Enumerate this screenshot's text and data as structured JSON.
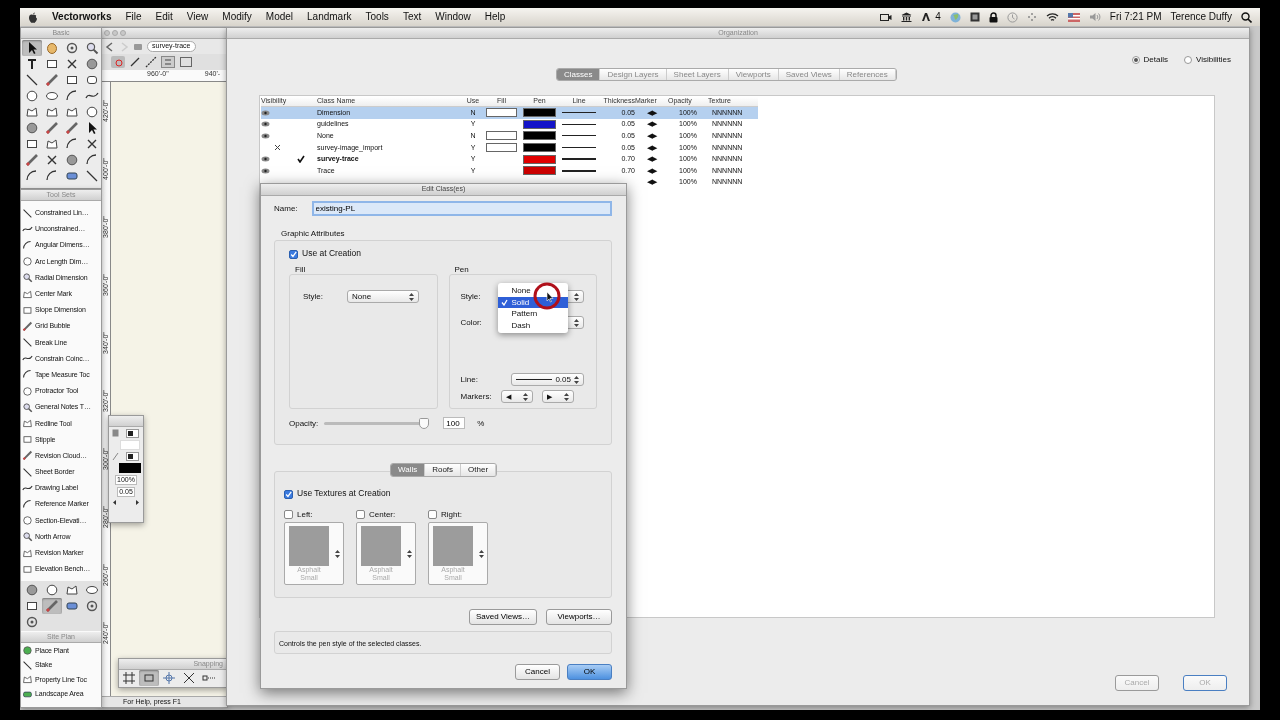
{
  "menu_bar": {
    "app": "Vectorworks",
    "menus": [
      "File",
      "Edit",
      "View",
      "Modify",
      "Model",
      "Landmark",
      "Tools",
      "Text",
      "Window",
      "Help"
    ],
    "status_count": "4",
    "clock": "Fri 7:21 PM",
    "user": "Terence Duffy"
  },
  "basic_palette": {
    "title": "Basic",
    "tools": [
      {
        "kind": "arrow",
        "selected": true
      },
      {
        "kind": "hand",
        "selected": false
      },
      {
        "kind": "pan",
        "selected": false
      },
      {
        "kind": "zoom",
        "selected": false
      },
      {
        "kind": "text",
        "selected": false
      },
      {
        "kind": "rect",
        "selected": false
      },
      {
        "kind": "cross",
        "selected": false
      },
      {
        "kind": "fill",
        "selected": false
      },
      {
        "kind": "line",
        "selected": false
      },
      {
        "kind": "pencil",
        "selected": false
      },
      {
        "kind": "rect",
        "selected": false
      },
      {
        "kind": "rrect",
        "selected": false
      },
      {
        "kind": "circle",
        "selected": false
      },
      {
        "kind": "oval",
        "selected": false
      },
      {
        "kind": "arc",
        "selected": false
      },
      {
        "kind": "curve",
        "selected": false
      },
      {
        "kind": "polygon",
        "selected": false
      },
      {
        "kind": "polygon",
        "selected": false
      },
      {
        "kind": "polygon",
        "selected": false
      },
      {
        "kind": "circle",
        "selected": false
      },
      {
        "kind": "fill",
        "selected": false
      },
      {
        "kind": "pencil",
        "selected": false
      },
      {
        "kind": "pencil",
        "selected": false
      },
      {
        "kind": "arrow",
        "selected": false
      },
      {
        "kind": "rect",
        "selected": false
      },
      {
        "kind": "polygon",
        "selected": false
      },
      {
        "kind": "arc",
        "selected": false
      },
      {
        "kind": "cross",
        "selected": false
      },
      {
        "kind": "pencil",
        "selected": false
      },
      {
        "kind": "cross",
        "selected": false
      },
      {
        "kind": "fill",
        "selected": false
      },
      {
        "kind": "arc",
        "selected": false
      },
      {
        "kind": "arc",
        "selected": false
      },
      {
        "kind": "arc",
        "selected": false
      },
      {
        "kind": "wall",
        "selected": false
      },
      {
        "kind": "line",
        "selected": false
      }
    ]
  },
  "tool_sets": {
    "title": "Tool Sets",
    "items": [
      "Constrained Lin…",
      "Unconstrained…",
      "Angular Dimens…",
      "Arc Length Dim…",
      "Radial Dimension",
      "Center Mark",
      "Slope Dimension",
      "Grid Bubble",
      "Break Line",
      "Constrain Coinc…",
      "Tape Measure Toc",
      "Protractor Tool",
      "General Notes T…",
      "Redline Tool",
      "Stipple",
      "Revision Cloud…",
      "Sheet Border",
      "Drawing Label",
      "Reference Marker",
      "Section-Elevati…",
      "North Arrow",
      "Revision Marker",
      "Elevation Bench…"
    ],
    "sets": [
      {
        "selected": false
      },
      {
        "selected": false
      },
      {
        "selected": false
      },
      {
        "selected": false
      },
      {
        "selected": false
      },
      {
        "selected": true
      },
      {
        "selected": false
      },
      {
        "selected": false
      },
      {
        "selected": false
      }
    ],
    "site_plan": {
      "title": "Site Plan",
      "items": [
        "Place Plant",
        "Stake",
        "Property Line Toc",
        "Landscape Area"
      ]
    }
  },
  "drawing_window": {
    "active_class": "survey-trace",
    "ruler_x": [
      "960'-0\"",
      "940'-"
    ],
    "ruler_y": [
      "420'-0\"",
      "400'-0\"",
      "380'-0\"",
      "360'-0\"",
      "340'-0\"",
      "320'-0\"",
      "300'-0\"",
      "280'-0\"",
      "260'-0\"",
      "240'-0\""
    ],
    "status": "For Help, press F1"
  },
  "attributes_palette": {
    "opacity": "100%",
    "thickness": "0.05"
  },
  "snapping_palette": {
    "title": "Snapping",
    "snaps": [
      {
        "selected": false
      },
      {
        "selected": true
      },
      {
        "selected": false
      },
      {
        "selected": false
      },
      {
        "selected": false
      }
    ]
  },
  "organization": {
    "title": "Organization",
    "views": [
      {
        "label": "Details",
        "selected": true
      },
      {
        "label": "Visibilities",
        "selected": false
      }
    ],
    "tabs": [
      {
        "label": "Classes",
        "selected": true
      },
      {
        "label": "Design Layers",
        "selected": false
      },
      {
        "label": "Sheet Layers",
        "selected": false
      },
      {
        "label": "Viewports",
        "selected": false
      },
      {
        "label": "Saved Views",
        "selected": false
      },
      {
        "label": "References",
        "selected": false
      }
    ],
    "table": {
      "columns": [
        "Visibility",
        "Class Name",
        "Use",
        "Fill",
        "Pen",
        "Line",
        "Thickness",
        "Marker",
        "Opacity",
        "Texture"
      ],
      "rows": [
        {
          "visible": true,
          "active": false,
          "name": "Dimension",
          "use": "N",
          "fill_swatch": true,
          "color": "#000000",
          "thick": false,
          "thickness": "0.05",
          "marker": "◀▶",
          "opacity": "100%",
          "texture": "NNNNNN",
          "selected": true
        },
        {
          "visible": true,
          "active": false,
          "name": "guidelines",
          "use": "Y",
          "fill_swatch": false,
          "color": "#1414c8",
          "thick": false,
          "thickness": "0.05",
          "marker": "◀▶",
          "opacity": "100%",
          "texture": "NNNNNN",
          "selected": false
        },
        {
          "visible": true,
          "active": false,
          "name": "None",
          "use": "N",
          "fill_swatch": true,
          "color": "#000000",
          "thick": false,
          "thickness": "0.05",
          "marker": "◀▶",
          "opacity": "100%",
          "texture": "NNNNNN",
          "selected": false
        },
        {
          "visible": false,
          "active": false,
          "name": "survey-image_import",
          "use": "Y",
          "fill_swatch": true,
          "color": "#000000",
          "thick": false,
          "thickness": "0.05",
          "marker": "◀▶",
          "opacity": "100%",
          "texture": "NNNNNN",
          "selected": false
        },
        {
          "visible": true,
          "active": true,
          "name": "survey-trace",
          "use": "Y",
          "fill_swatch": false,
          "color": "#e00000",
          "thick": true,
          "thickness": "0.70",
          "marker": "◀▶",
          "opacity": "100%",
          "texture": "NNNNNN",
          "selected": false
        },
        {
          "visible": true,
          "active": false,
          "name": "Trace",
          "use": "Y",
          "fill_swatch": false,
          "color": "#cc0000",
          "thick": true,
          "thickness": "0.70",
          "marker": "◀▶",
          "opacity": "100%",
          "texture": "NNNNNN",
          "selected": false
        },
        {
          "marker": "◀▶",
          "opacity": "100%",
          "texture": "NNNNNN",
          "selected": false
        }
      ]
    },
    "buttons": [
      {
        "label": "Cancel",
        "disabled": true
      },
      {
        "label": "OK",
        "disabled": true
      }
    ]
  },
  "dialog": {
    "title": "Edit Class(es)",
    "name_label": "Name:",
    "name_value": "existing-PL",
    "graphic_title": "Graphic Attributes",
    "use_at_creation": {
      "label": "Use at Creation",
      "checked": true
    },
    "fill": {
      "title": "Fill",
      "style_label": "Style:",
      "style": "None"
    },
    "pen": {
      "title": "Pen",
      "style_label": "Style:",
      "style_menu": [
        {
          "label": "None",
          "selected": false
        },
        {
          "label": "Solid",
          "selected": true
        },
        {
          "label": "Pattern",
          "selected": false
        },
        {
          "label": "Dash",
          "selected": false
        }
      ],
      "color_label": "Color:",
      "line_label": "Line:",
      "line": "0.05",
      "markers_label": "Markers:",
      "markers": [
        "◀",
        "▶"
      ]
    },
    "opacity": {
      "label": "Opacity:",
      "level": 1,
      "value": "100",
      "unit": "%"
    },
    "tabs": [
      {
        "label": "Walls",
        "selected": true
      },
      {
        "label": "Roofs",
        "selected": false
      },
      {
        "label": "Other",
        "selected": false
      }
    ],
    "use_textures": {
      "label": "Use Textures at Creation",
      "checked": true
    },
    "textures": [
      {
        "label": "Left:",
        "checked": false,
        "swatch": "Asphalt Small"
      },
      {
        "label": "Center:",
        "checked": false,
        "swatch": "Asphalt Small"
      },
      {
        "label": "Right:",
        "checked": false,
        "swatch": "Asphalt Small"
      }
    ],
    "buttons": [
      "Saved Views…",
      "Viewports…"
    ],
    "help": "Controls the pen style of the selected classes.",
    "footer": [
      {
        "label": "Cancel",
        "default": false
      },
      {
        "label": "OK",
        "default": true
      }
    ]
  }
}
